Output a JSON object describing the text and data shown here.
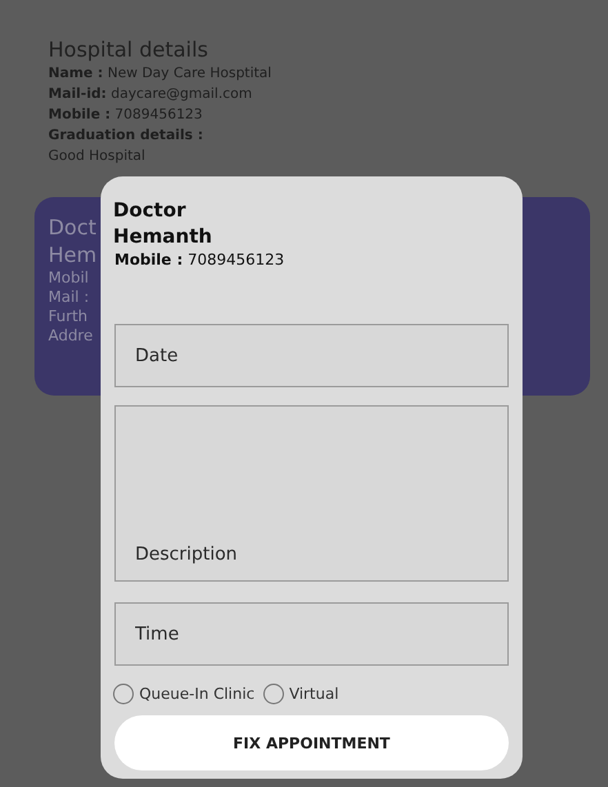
{
  "hospital": {
    "title": "Hospital details",
    "lines": [
      {
        "label": "Name :",
        "value": "New Day Care Hosptital"
      },
      {
        "label": "Mail-id:",
        "value": "daycare@gmail.com"
      },
      {
        "label": "Mobile :",
        "value": "7089456123"
      },
      {
        "label": "Graduation details :"
      }
    ],
    "graduation": "Good Hospital"
  },
  "doctor_card": {
    "lines": [
      "Doct",
      "Hem",
      "Mobil",
      "Mail :",
      "Furth",
      "Addre"
    ]
  },
  "dialog": {
    "title": "Doctor",
    "name": "Hemanth",
    "mobile_label": "Mobile :",
    "mobile": "7089456123",
    "fields": [
      {
        "kind": "line",
        "placeholder": "Date"
      },
      {
        "kind": "area",
        "placeholder": "Description"
      },
      {
        "kind": "line",
        "placeholder": "Time"
      }
    ],
    "options": [
      {
        "label": "Queue-In Clinic",
        "selected": false
      },
      {
        "label": "Virtual",
        "selected": false
      }
    ],
    "button": "FIX APPOINTMENT"
  }
}
